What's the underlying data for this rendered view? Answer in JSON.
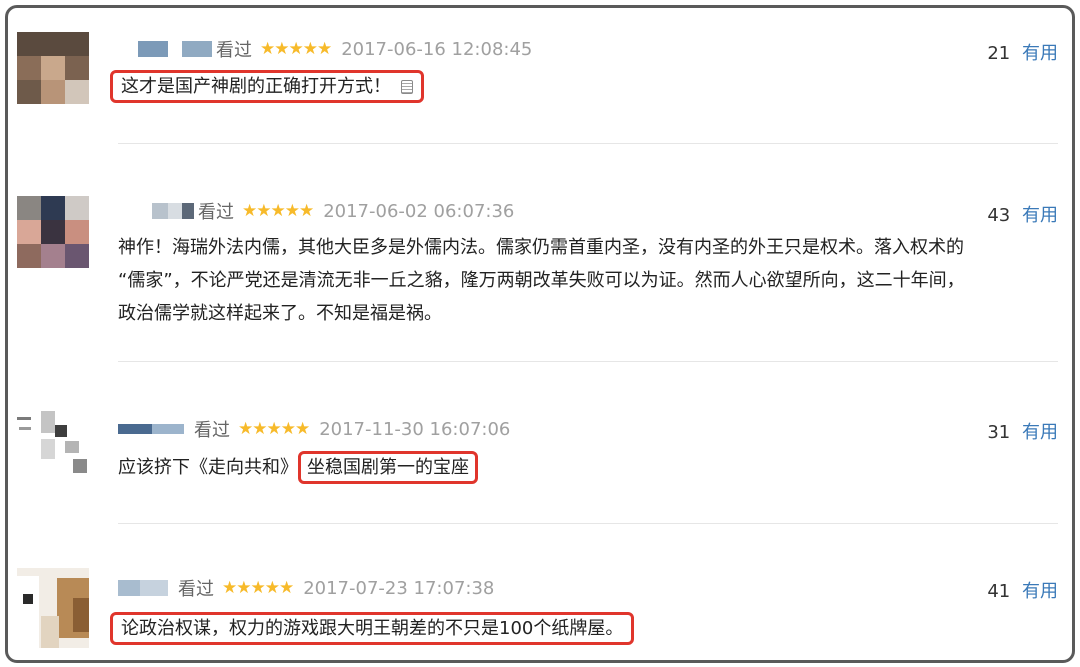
{
  "colors": {
    "accent": "#3a79b8",
    "star": "#f7ba2a",
    "highlight": "#e0352c",
    "frame": "#5a5a5a"
  },
  "reviews": [
    {
      "status": "看过",
      "stars": "★★★★★",
      "time": "2017-06-16 12:08:45",
      "votes": "21",
      "useful_label": "有用",
      "content": "这才是国产神剧的正确打开方式！"
    },
    {
      "status": "看过",
      "stars": "★★★★★",
      "time": "2017-06-02 06:07:36",
      "votes": "43",
      "useful_label": "有用",
      "content_lines": [
        "神作！海瑞外法内儒，其他大臣多是外儒内法。儒家仍需首重内圣，没有内圣的外王只是权术。落入权术的",
        "“儒家”，不论严党还是清流无非一丘之貉，隆万两朝改革失败可以为证。然而人心欲望所向，这二十年间，",
        "政治儒学就这样起来了。不知是福是祸。"
      ]
    },
    {
      "status": "看过",
      "stars": "★★★★★",
      "time": "2017-11-30 16:07:06",
      "votes": "31",
      "useful_label": "有用",
      "content_prefix": "应该挤下《走向共和》",
      "content_highlight": "坐稳国剧第一的宝座"
    },
    {
      "status": "看过",
      "stars": "★★★★★",
      "time": "2017-07-23 17:07:38",
      "votes": "41",
      "useful_label": "有用",
      "content": "论政治权谋，权力的游戏跟大明王朝差的不只是100个纸牌屋。"
    }
  ]
}
